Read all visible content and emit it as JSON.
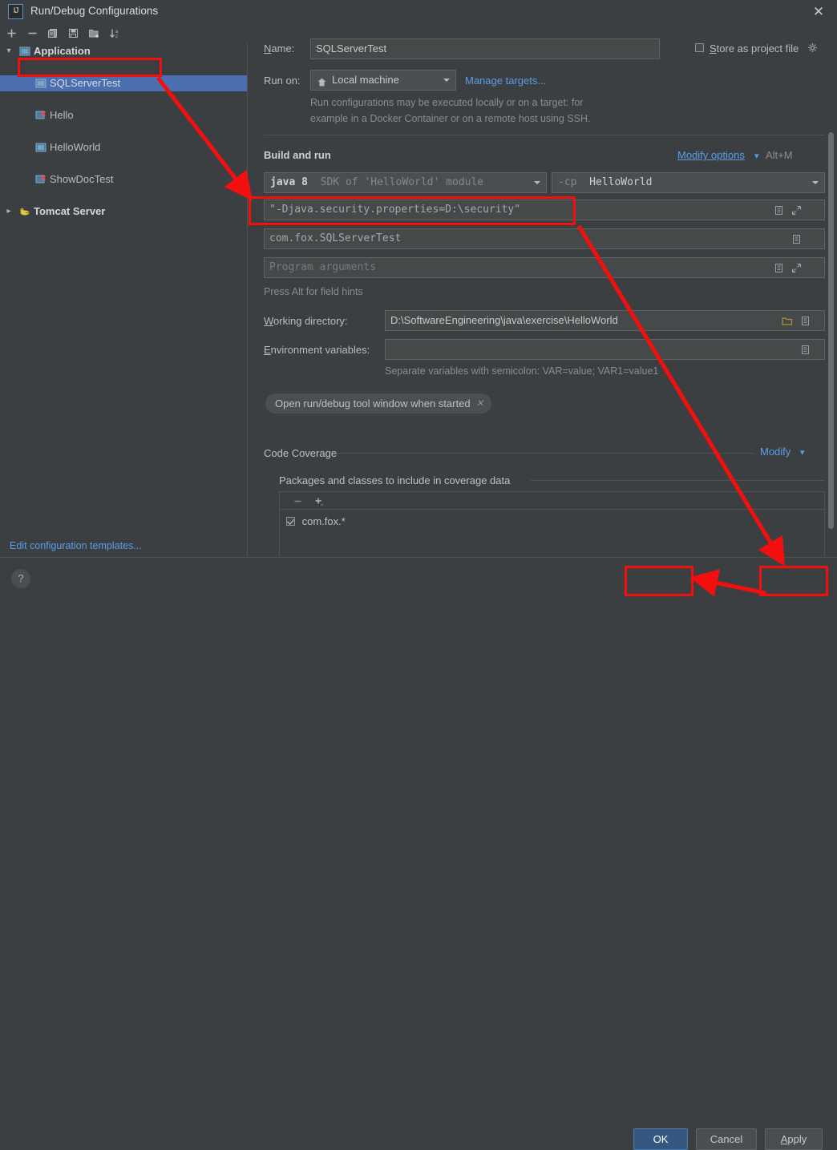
{
  "window": {
    "title": "Run/Debug Configurations",
    "logo_text": "IJ",
    "close_icon": "close-icon"
  },
  "sidebar": {
    "toolbar": [
      {
        "name": "add-icon",
        "glyph": "+"
      },
      {
        "name": "remove-icon",
        "glyph": "−"
      },
      {
        "name": "copy-icon",
        "glyph": "copy"
      },
      {
        "name": "save-icon",
        "glyph": "save"
      },
      {
        "name": "new-folder-icon",
        "glyph": "folder-plus"
      },
      {
        "name": "sort-alphabetically-icon",
        "glyph": "sort-az"
      }
    ],
    "tree": [
      {
        "label": "Application",
        "level": 0,
        "bold": true,
        "expanded": true,
        "selected": false,
        "icon": "application-icon",
        "error": false
      },
      {
        "label": "SQLServerTest",
        "level": 1,
        "bold": false,
        "expanded": null,
        "selected": true,
        "icon": "run-config-icon",
        "error": false
      },
      {
        "label": "Hello",
        "level": 1,
        "bold": false,
        "expanded": null,
        "selected": false,
        "icon": "run-config-icon",
        "error": true
      },
      {
        "label": "HelloWorld",
        "level": 1,
        "bold": false,
        "expanded": null,
        "selected": false,
        "icon": "run-config-icon",
        "error": false
      },
      {
        "label": "ShowDocTest",
        "level": 1,
        "bold": false,
        "expanded": null,
        "selected": false,
        "icon": "run-config-icon",
        "error": true
      },
      {
        "label": "Tomcat Server",
        "level": 0,
        "bold": true,
        "expanded": false,
        "selected": false,
        "icon": "tomcat-icon",
        "error": false
      }
    ],
    "edit_templates_link": "Edit configuration templates..."
  },
  "form": {
    "name_label": "Name:",
    "name_label_mnemonic": "N",
    "name_value": "SQLServerTest",
    "store_as_project_file_label": "Store as project file",
    "store_as_project_file_checked": false,
    "store_gear_icon": "gear-icon",
    "run_on_label": "Run on:",
    "run_on_value": "Local machine",
    "run_on_icon": "home-icon",
    "manage_targets_link": "Manage targets...",
    "hint_line1": "Run configurations may be executed locally or on a target: for",
    "hint_line2": "example in a Docker Container or on a remote host using SSH.",
    "build_and_run_title": "Build and run",
    "modify_options_link": "Modify options",
    "modify_options_shortcut": "Alt+M",
    "jre_value_bold": "java 8",
    "jre_value_rest": "SDK of 'HelloWorld' module",
    "classpath_value_prefix": "-cp",
    "classpath_value": "HelloWorld",
    "vm_options_value": "\"-Djava.security.properties=D:\\security\"",
    "main_class_value": "com.fox.SQLServerTest",
    "program_arguments_placeholder": "Program arguments",
    "field_hints_text": "Press Alt for field hints",
    "working_directory_label": "Working directory:",
    "working_directory_mnemonic": "W",
    "working_directory_value": "D:\\SoftwareEngineering\\java\\exercise\\HelloWorld",
    "environment_variables_label": "Environment variables:",
    "environment_variables_mnemonic": "E",
    "environment_variables_value": "",
    "environment_hint": "Separate variables with semicolon: VAR=value; VAR1=value1",
    "chip_label": "Open run/debug tool window when started",
    "chip_close_icon": "close-icon",
    "code_coverage_title": "Code Coverage",
    "code_coverage_modify_link": "Modify",
    "coverage_packages_title": "Packages and classes to include in coverage data",
    "coverage_list": [
      {
        "label": "com.fox.*",
        "checked": true
      }
    ],
    "coverage_toolbar": [
      {
        "name": "remove-icon",
        "glyph": "−"
      },
      {
        "name": "add-icon",
        "glyph": "+"
      }
    ],
    "expand_icon": "expand-editor-icon",
    "maximize_icon": "maximize-icon",
    "browse_icon": "browse-folder-icon"
  },
  "buttons": {
    "help_label": "?",
    "ok_label": "OK",
    "cancel_label": "Cancel",
    "apply_label": "Apply",
    "apply_mnemonic": "A"
  },
  "annotations": {
    "accent_color": "#f40f0f",
    "highlight_boxes": [
      "sidebar-sqlservertest",
      "vm-options-field",
      "ok-button",
      "apply-button"
    ],
    "arrows": [
      "sqlservertest-to-vm-options",
      "apply-to-ok"
    ]
  }
}
